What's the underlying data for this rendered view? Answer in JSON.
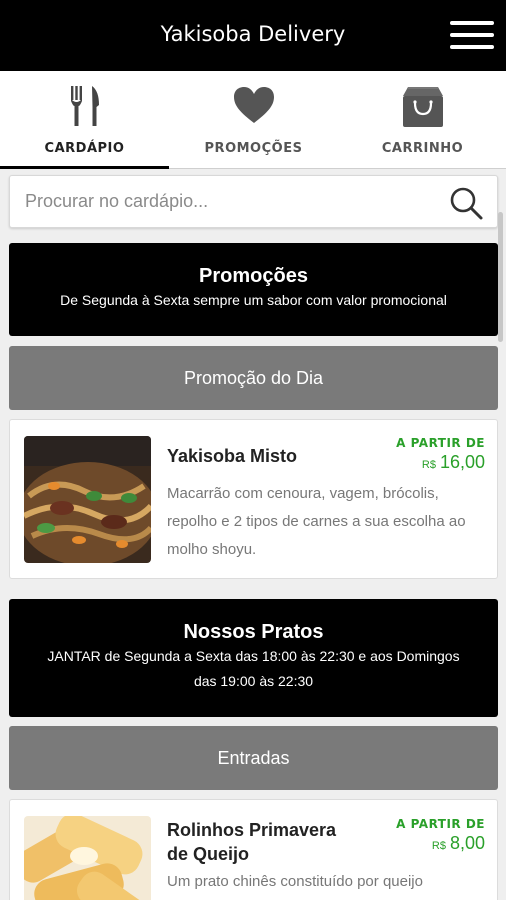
{
  "header": {
    "title": "Yakisoba Delivery",
    "menu_icon": "hamburger-menu-icon"
  },
  "tabs": [
    {
      "label": "CARDÁPIO",
      "icon": "fork-knife-icon",
      "active": true
    },
    {
      "label": "PROMOÇÕES",
      "icon": "heart-icon",
      "active": false
    },
    {
      "label": "CARRINHO",
      "icon": "shopping-bag-icon",
      "active": false
    }
  ],
  "search": {
    "placeholder": "Procurar no cardápio...",
    "icon": "search-icon"
  },
  "promo_section": {
    "title": "Promoções",
    "subtitle": "De Segunda à Sexta sempre um sabor com valor promocional",
    "category": "Promoção do Dia",
    "items": [
      {
        "name": "Yakisoba Misto",
        "from_label": "A PARTIR DE",
        "currency": "R$",
        "price": "16,00",
        "description": "Macarrão com cenoura, vagem, brócolis, repolho e 2 tipos de carnes a sua escolha ao molho shoyu."
      }
    ]
  },
  "dishes_section": {
    "title": "Nossos Pratos",
    "subtitle_line1": "JANTAR de Segunda a Sexta das 18:00 às 22:30 e aos Domingos",
    "subtitle_line2": "das 19:00 às 22:30",
    "category": "Entradas",
    "items": [
      {
        "name_line1": "Rolinhos Primavera",
        "name_line2": "de Queijo",
        "from_label": "A PARTIR DE",
        "currency": "R$",
        "price": "8,00",
        "description": "Um prato chinês constituído por queijo"
      }
    ]
  },
  "colors": {
    "header_bg": "#000000",
    "accent_price": "#2aa02a",
    "category_bar": "#7a7a7a"
  }
}
